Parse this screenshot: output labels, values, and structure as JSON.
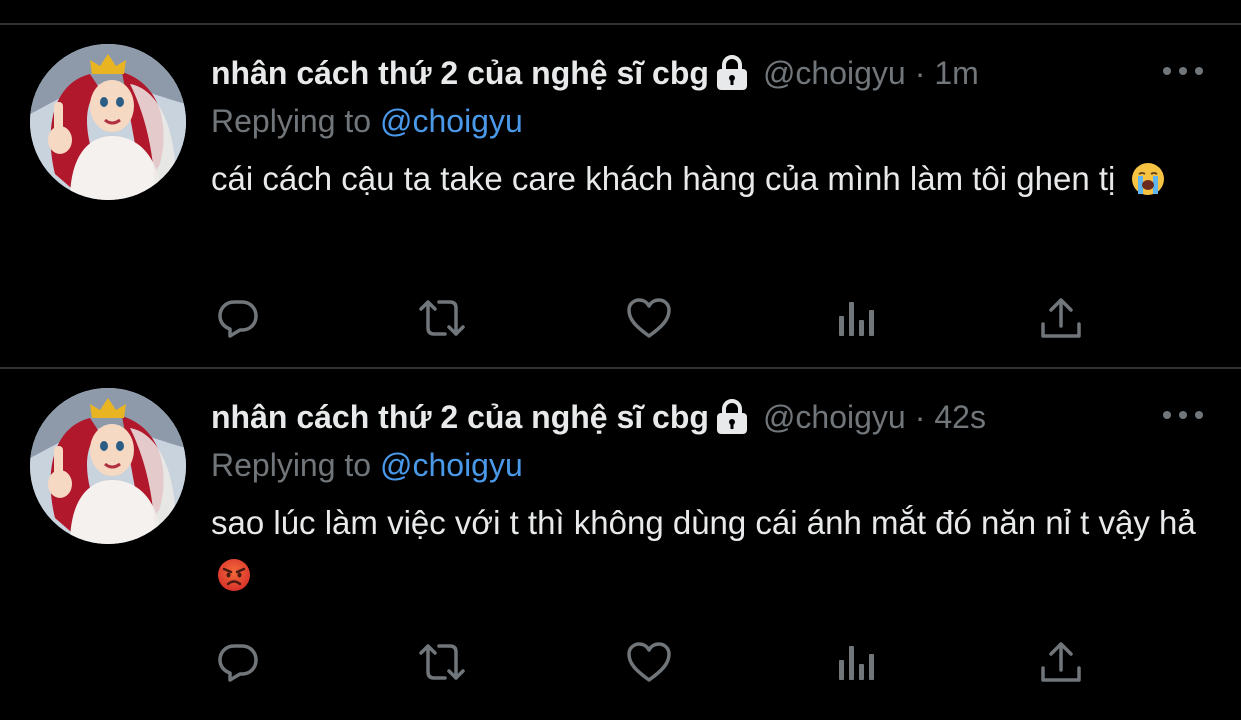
{
  "tweets": [
    {
      "display_name": "nhân cách thứ 2 của nghệ sĩ cbg",
      "handle": "@choigyu",
      "separator": "·",
      "time": "1m",
      "reply_prefix": "Replying to",
      "reply_handle": "@choigyu",
      "text": "cái cách cậu ta take care khách hàng của mình làm tôi ghen tị",
      "emoji": "loudly-crying-face"
    },
    {
      "display_name": "nhân cách thứ 2 của nghệ sĩ cbg",
      "handle": "@choigyu",
      "separator": "·",
      "time": "42s",
      "reply_prefix": "Replying to",
      "reply_handle": "@choigyu",
      "text": "sao lúc làm việc với t thì không dùng cái ánh mắt đó năn nỉ t vậy hả",
      "emoji": "angry-face"
    }
  ],
  "icons": {
    "reply": "reply-icon",
    "retweet": "retweet-icon",
    "like": "heart-icon",
    "analytics": "analytics-icon",
    "share": "share-icon",
    "more": "more-icon",
    "lock": "lock-icon"
  },
  "colors": {
    "background": "#000000",
    "text": "#e7e9ea",
    "muted": "#71767b",
    "link": "#4a99e9",
    "divider": "#2f3336"
  }
}
